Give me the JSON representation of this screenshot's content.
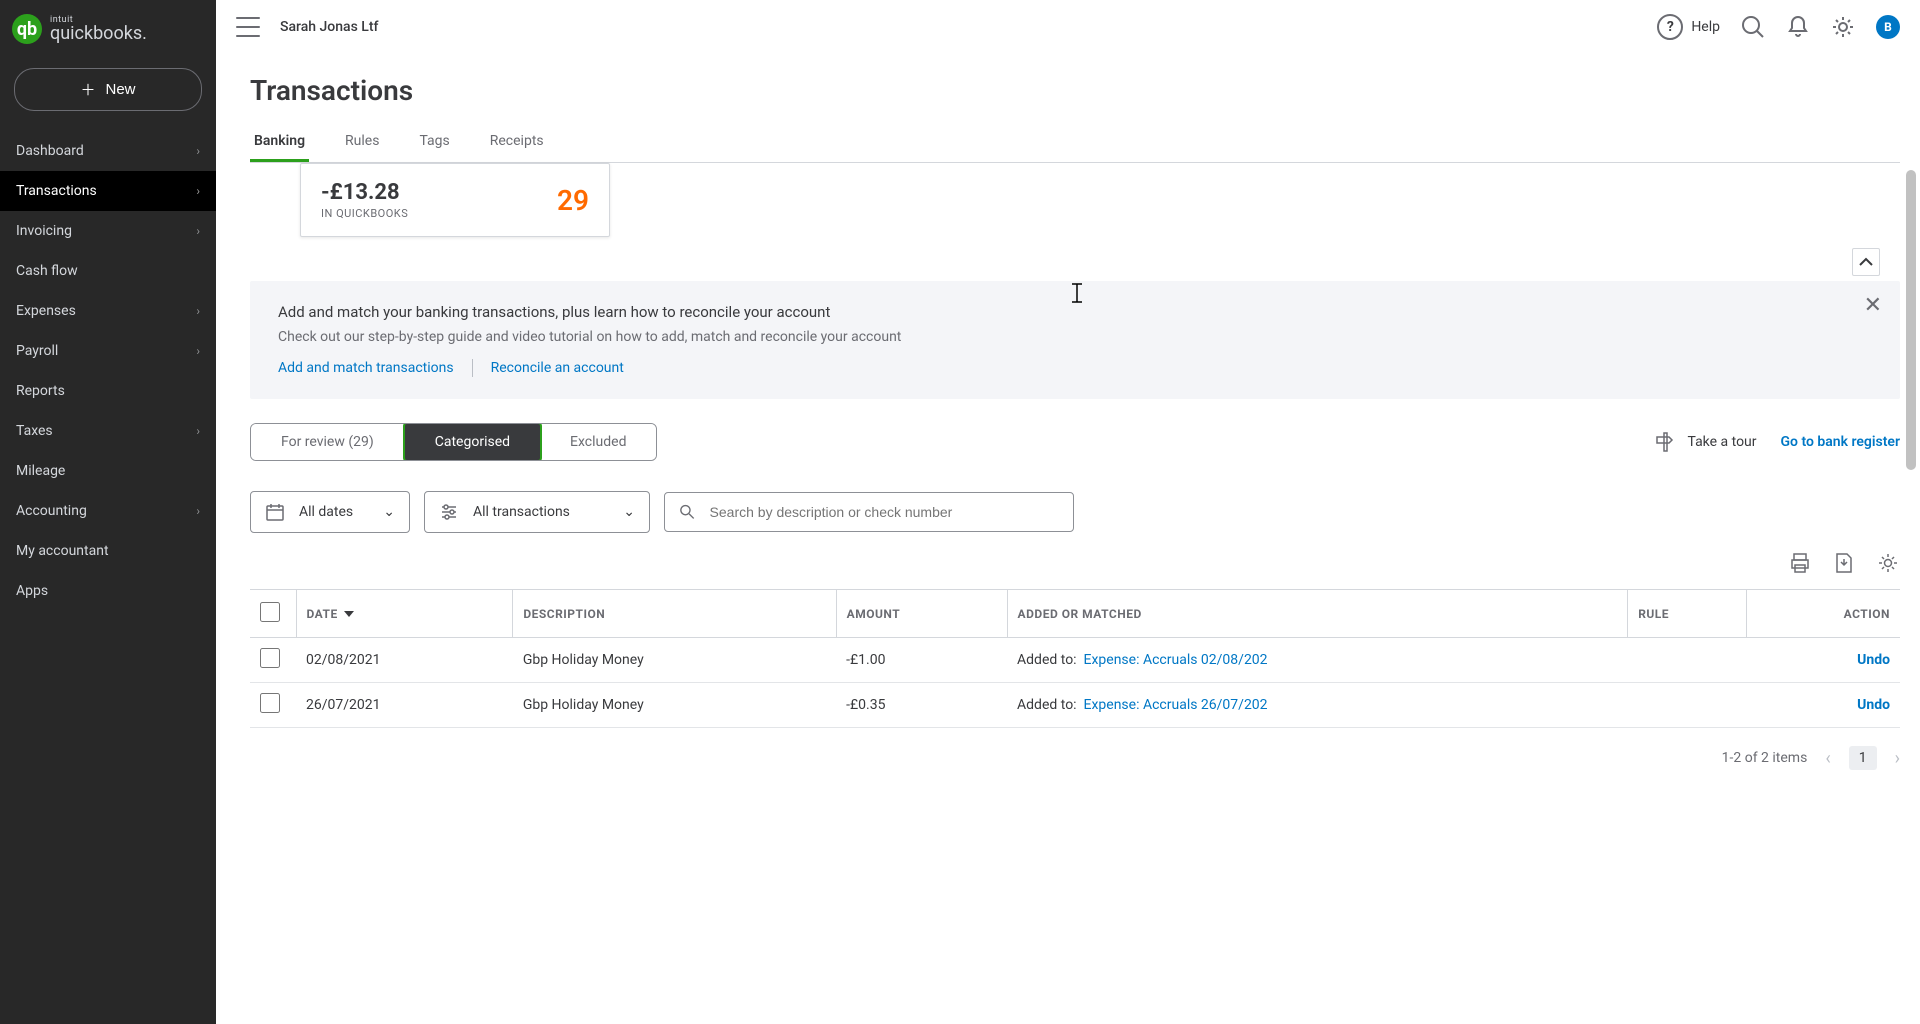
{
  "company": "Sarah Jonas Ltf",
  "help_label": "Help",
  "avatar_letter": "B",
  "logo": {
    "intuit": "intuit",
    "name": "quickbooks."
  },
  "new_button": "New",
  "sidebar": {
    "items": [
      {
        "label": "Dashboard",
        "chev": true
      },
      {
        "label": "Transactions",
        "chev": true,
        "active": true
      },
      {
        "label": "Invoicing",
        "chev": true
      },
      {
        "label": "Cash flow",
        "chev": false
      },
      {
        "label": "Expenses",
        "chev": true
      },
      {
        "label": "Payroll",
        "chev": true
      },
      {
        "label": "Reports",
        "chev": false
      },
      {
        "label": "Taxes",
        "chev": true
      },
      {
        "label": "Mileage",
        "chev": false
      },
      {
        "label": "Accounting",
        "chev": true
      },
      {
        "label": "My accountant",
        "chev": false
      },
      {
        "label": "Apps",
        "chev": false
      }
    ]
  },
  "page_title": "Transactions",
  "subtabs": [
    {
      "label": "Banking",
      "active": true
    },
    {
      "label": "Rules"
    },
    {
      "label": "Tags"
    },
    {
      "label": "Receipts"
    }
  ],
  "account_card": {
    "amount": "-£13.28",
    "label": "IN QUICKBOOKS",
    "count": "29"
  },
  "info": {
    "title": "Add and match your banking transactions, plus learn how to reconcile your account",
    "sub": "Check out our step-by-step guide and video tutorial on how to add, match and reconcile your account",
    "link1": "Add and match transactions",
    "link2": "Reconcile an account"
  },
  "segments": [
    {
      "label": "For review (29)"
    },
    {
      "label": "Categorised",
      "active": true
    },
    {
      "label": "Excluded"
    }
  ],
  "tour": "Take a tour",
  "register": "Go to bank register",
  "filters": {
    "dates": "All dates",
    "txn": "All transactions",
    "search_ph": "Search by description or check number"
  },
  "table": {
    "headers": {
      "date": "DATE",
      "desc": "DESCRIPTION",
      "amount": "AMOUNT",
      "added": "ADDED OR MATCHED",
      "rule": "RULE",
      "action": "ACTION"
    },
    "rows": [
      {
        "date": "02/08/2021",
        "desc": "Gbp Holiday Money",
        "amount": "-£1.00",
        "added_prefix": "Added to:",
        "added_link": "Expense: Accruals 02/08/202",
        "undo": "Undo"
      },
      {
        "date": "26/07/2021",
        "desc": "Gbp Holiday Money",
        "amount": "-£0.35",
        "added_prefix": "Added to:",
        "added_link": "Expense: Accruals 26/07/202",
        "undo": "Undo"
      }
    ]
  },
  "pagination": {
    "range": "1-2 of 2 items",
    "page": "1"
  }
}
